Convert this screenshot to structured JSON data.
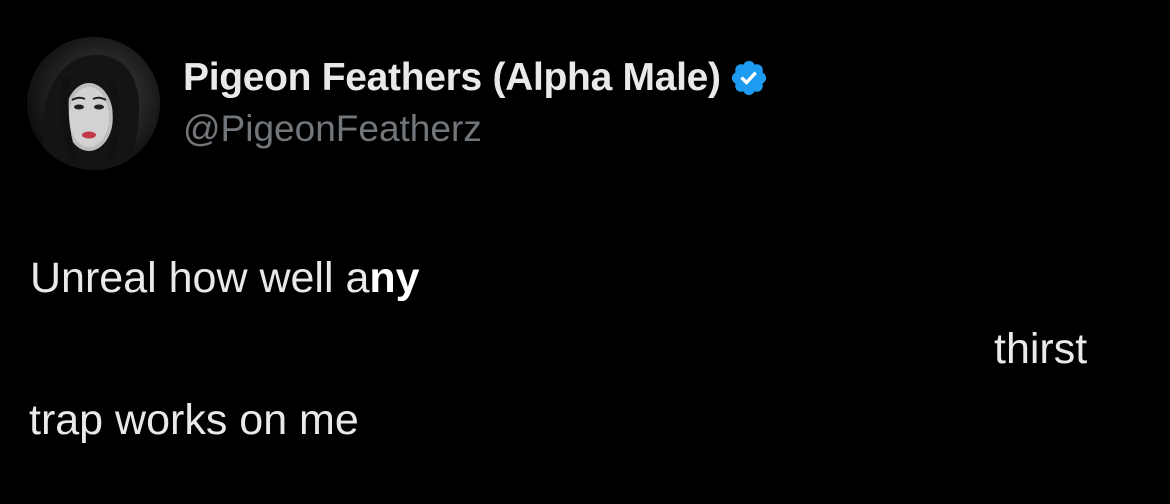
{
  "author": {
    "display_name": "Pigeon Feathers (Alpha Male)",
    "handle": "@PigeonFeatherz",
    "verified_icon": "verified-badge-icon",
    "verified_color": "#1d9bf0"
  },
  "tweet": {
    "line1_plain": "Unreal how well a",
    "line1_bold": "ny",
    "line2": "thirst",
    "line3": "trap works on me"
  },
  "colors": {
    "background": "#000000",
    "text": "#e7e9ea",
    "secondary_text": "#71767b"
  }
}
